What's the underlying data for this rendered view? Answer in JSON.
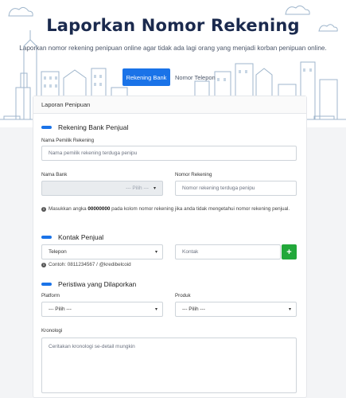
{
  "hero": {
    "title": "Laporkan Nomor Rekening",
    "subtitle": "Laporkan nomor rekening penipuan online agar tidak ada lagi orang yang menjadi korban penipuan online.",
    "tab_active": "Rekening Bank",
    "tab_inactive": "Nomor Telepon"
  },
  "card": {
    "header": "Laporan Penipuan"
  },
  "section_bank": {
    "title": "Rekening Bank Penjual",
    "owner_label": "Nama Pemilik Rekening",
    "owner_placeholder": "Nama pemilik rekening terduga penipu",
    "bank_label": "Nama Bank",
    "bank_value": "--- Pilih ---",
    "account_label": "Nomor Rekening",
    "account_placeholder": "Nomor rekening terduga penipu",
    "info_prefix": "Masukkan angka ",
    "info_bold": "00000000",
    "info_suffix": " pada kolom nomor rekening jika anda tidak mengetahui nomor rekening penjual."
  },
  "section_contact": {
    "title": "Kontak Penjual",
    "type_value": "Telepon",
    "contact_placeholder": "Kontak",
    "add_label": "+",
    "example": "Contoh: 0811234567 / @kredibelcoid"
  },
  "section_event": {
    "title": "Peristiwa yang Dilaporkan",
    "platform_label": "Platform",
    "platform_value": "--- Pilih ---",
    "product_label": "Produk",
    "product_value": "--- Pilih ---",
    "chronology_label": "Kronologi",
    "chronology_placeholder": "Ceritakan kronologi se-detail mungkin"
  },
  "colors": {
    "accent": "#1a73e8",
    "add_button": "#22a83a",
    "title": "#1b2a4e"
  }
}
